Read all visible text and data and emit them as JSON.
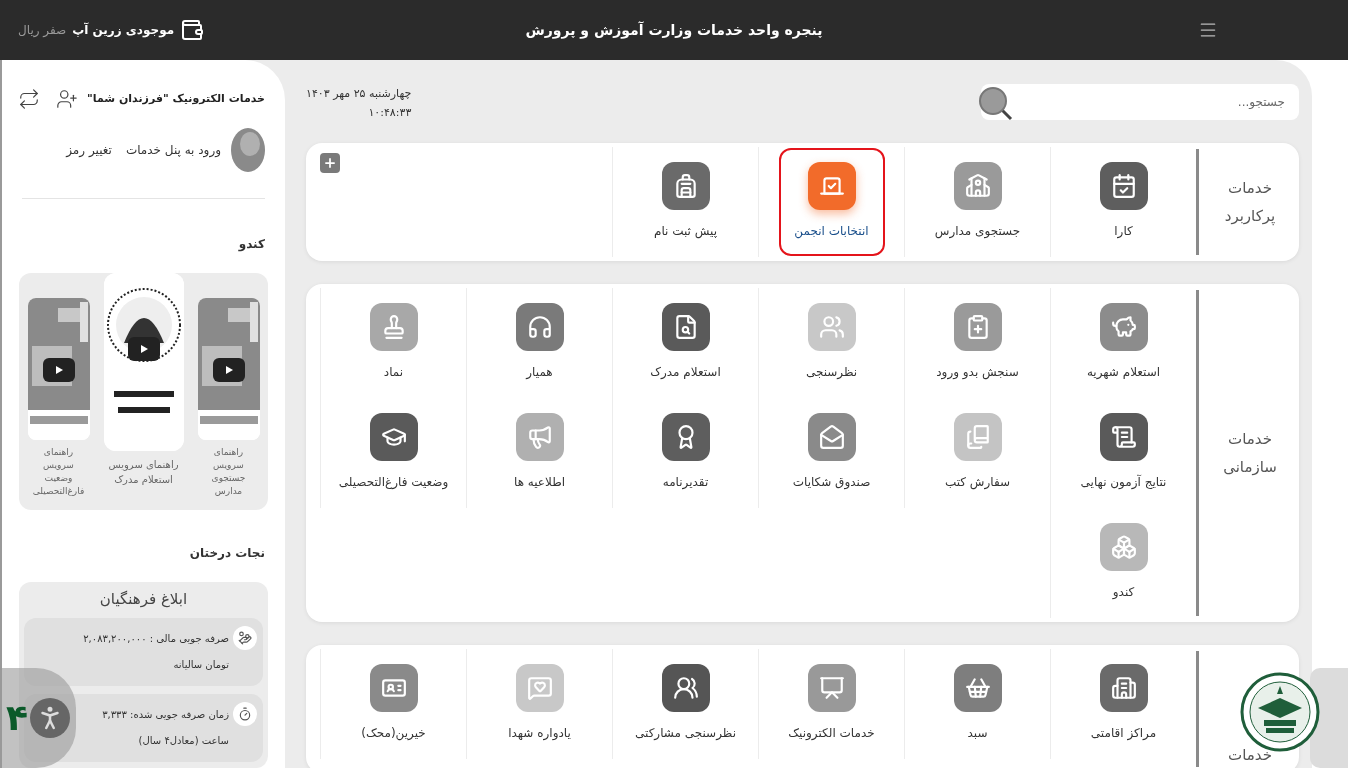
{
  "top_bar": {
    "title": "پنجره واحد خدمات وزارت آموزش و پرورش",
    "wallet_label": "موجودی زرین آپ",
    "wallet_balance": "صفر ریال"
  },
  "sidebar": {
    "title": "خدمات الکترونیک \"فرزندان شما\"",
    "links": [
      "ورود به پنل خدمات",
      "تغییر رمز"
    ],
    "kondo": {
      "heading": "کندو",
      "slides": [
        {
          "caption": "راهنمای سرویس جستجوی مدارس",
          "selected": false
        },
        {
          "caption": "راهنمای سرویس استعلام مدرک",
          "selected": true
        },
        {
          "caption": "راهنمای سرویس وضعیت فارغ‌التحصیلی",
          "selected": false
        }
      ]
    },
    "savings": {
      "heading": "نجات درختان",
      "card_title": "ابلاغ فرهنگیان",
      "rows": [
        {
          "kind": "money",
          "text": "صرفه جویی مالی : ۲,۰۸۳,۲۰۰,۰۰۰ تومان سالیانه"
        },
        {
          "kind": "time",
          "text": "زمان صرفه جویی شده: ۳,۳۳۳ ساعت (معادل۴ سال)"
        }
      ]
    }
  },
  "header": {
    "date": "چهارشنبه ۲۵ مهر ۱۴۰۳",
    "time": "۱۰:۴۸:۳۳",
    "search": {
      "placeholder": "جستجو..."
    }
  },
  "sections": [
    {
      "title": "خدمات پرکاربرد",
      "add_button": true,
      "items": [
        {
          "label": "کارا",
          "color": "#5e5e5e",
          "selected": false
        },
        {
          "label": "جستجوی مدارس",
          "color": "#9a9a9a",
          "selected": false
        },
        {
          "label": "انتخابات انجمن",
          "color": "#f26b2a",
          "selected": true
        },
        {
          "label": "پیش ثبت نام",
          "color": "#6a6a6a",
          "selected": false
        }
      ]
    },
    {
      "title": "خدمات سازمانی",
      "items": [
        {
          "label": "استعلام شهریه",
          "color": "#8c8c8c"
        },
        {
          "label": "سنجش بدو ورود",
          "color": "#9a9a9a"
        },
        {
          "label": "نظرسنجی",
          "color": "#c8c8c8"
        },
        {
          "label": "استعلام مدرک",
          "color": "#5a5a5a"
        },
        {
          "label": "همیار",
          "color": "#7a7a7a"
        },
        {
          "label": "نماد",
          "color": "#a8a8a8"
        },
        {
          "label": "نتایج آزمون نهایی",
          "color": "#5a5a5a"
        },
        {
          "label": "سفارش کتب",
          "color": "#c4c4c4"
        },
        {
          "label": "صندوق شکایات",
          "color": "#8a8a8a"
        },
        {
          "label": "تقدیرنامه",
          "color": "#5e5e5e"
        },
        {
          "label": "اطلاعیه ها",
          "color": "#b0b0b0"
        },
        {
          "label": "وضعیت فارغ‌التحصیلی",
          "color": "#5a5a5a"
        },
        {
          "label": "کندو",
          "color": "#b8b8b8"
        }
      ]
    },
    {
      "title": "خدمات",
      "items": [
        {
          "label": "مراکز اقامتی",
          "color": "#6a6a6a"
        },
        {
          "label": "سبد",
          "color": "#7e7e7e"
        },
        {
          "label": "خدمات الکترونیک",
          "color": "#999999"
        },
        {
          "label": "نظرسنجی مشارکتی",
          "color": "#555555"
        },
        {
          "label": "یادواره شهدا",
          "color": "#c8c8c8"
        },
        {
          "label": "خیرین(محک)",
          "color": "#8a8a8a"
        }
      ]
    }
  ],
  "accessibility_widget": {
    "label": "۴"
  }
}
